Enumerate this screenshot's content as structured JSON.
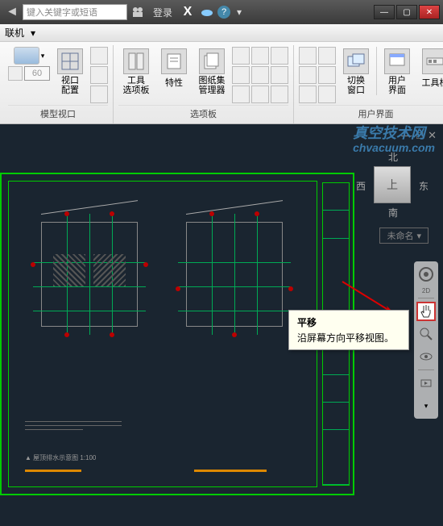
{
  "titlebar": {
    "search_placeholder": "键入关键字或短语",
    "login": "登录"
  },
  "menubar": {
    "item1": "联机",
    "dropdown": "▾"
  },
  "scale_value": "60",
  "ribbon": {
    "viewport_config": "视口\n配置",
    "tool_options": "工具\n选项板",
    "properties": "特性",
    "sheetset_mgr": "图纸集\n管理器",
    "switch_window": "切换\n窗口",
    "user_interface": "用户\n界面",
    "toolbar": "工具栏",
    "group_model_viewport": "模型视口",
    "group_options": "选项板",
    "group_ui": "用户界面"
  },
  "watermark": {
    "line1": "真空技术网",
    "line2": "chvacuum.com"
  },
  "viewcube": {
    "face": "上",
    "north": "北",
    "south": "南",
    "east": "东",
    "west": "西",
    "name": "未命名",
    "arrow": "▾"
  },
  "tooltip": {
    "title": "平移",
    "desc": "沿屏幕方向平移视图。"
  },
  "doc_controls": {
    "min": "—",
    "max": "□",
    "close": "✕"
  },
  "win_controls": {
    "min": "—",
    "max": "▢",
    "close": "✕"
  },
  "drawing": {
    "legend_label": "▲ 屋顶排水示意图  1:100"
  }
}
